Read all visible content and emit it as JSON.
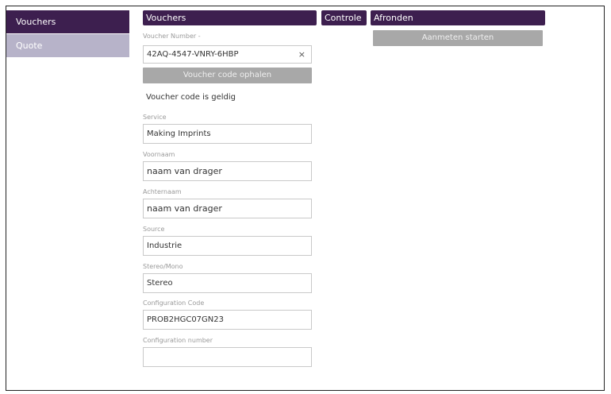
{
  "sidebar": {
    "items": [
      {
        "label": "Vouchers"
      },
      {
        "label": "Quote"
      }
    ]
  },
  "headers": {
    "vouchers": "Vouchers",
    "controle": "Controle",
    "afronden": "Afronden"
  },
  "voucher": {
    "number_label": "Voucher Number -",
    "number_value": "42AQ-4547-VNRY-6HBP",
    "clear_symbol": "×",
    "fetch_button": "Voucher code ophalen",
    "status_message": "Voucher code is geldig"
  },
  "afronden": {
    "start_button": "Aanmeten starten"
  },
  "form": {
    "service": {
      "label": "Service",
      "value": "Making Imprints"
    },
    "voornaam": {
      "label": "Voornaam",
      "value": "naam van drager"
    },
    "achternaam": {
      "label": "Achternaam",
      "value": "naam van drager"
    },
    "source": {
      "label": "Source",
      "value": "Industrie"
    },
    "stereo_mono": {
      "label": "Stereo/Mono",
      "value": "Stereo"
    },
    "configuration_code": {
      "label": "Configuration Code",
      "value": "PROB2HGC07GN23"
    },
    "configuration_number": {
      "label": "Configuration number",
      "value": ""
    }
  },
  "colors": {
    "accent": "#3d1f4f",
    "sidebar_inactive": "#b7b3c9",
    "button_gray": "#a8a8a8"
  }
}
